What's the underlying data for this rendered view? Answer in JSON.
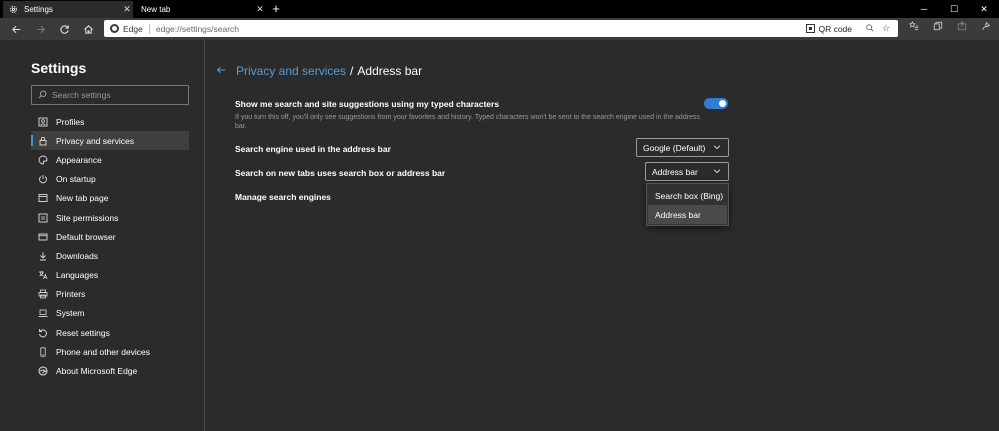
{
  "tabs": [
    {
      "title": "Settings"
    },
    {
      "title": "New tab"
    }
  ],
  "toolbar": {
    "site_label": "Edge",
    "url": "edge://settings/search",
    "qr_label": "QR code"
  },
  "sidebar": {
    "title": "Settings",
    "search_placeholder": "Search settings",
    "items": [
      {
        "label": "Profiles",
        "icon": "profile-icon"
      },
      {
        "label": "Privacy and services",
        "icon": "lock-icon"
      },
      {
        "label": "Appearance",
        "icon": "palette-icon"
      },
      {
        "label": "On startup",
        "icon": "power-icon"
      },
      {
        "label": "New tab page",
        "icon": "newtab-icon"
      },
      {
        "label": "Site permissions",
        "icon": "permissions-icon"
      },
      {
        "label": "Default browser",
        "icon": "browser-icon"
      },
      {
        "label": "Downloads",
        "icon": "download-icon"
      },
      {
        "label": "Languages",
        "icon": "language-icon"
      },
      {
        "label": "Printers",
        "icon": "printer-icon"
      },
      {
        "label": "System",
        "icon": "laptop-icon"
      },
      {
        "label": "Reset settings",
        "icon": "reset-icon"
      },
      {
        "label": "Phone and other devices",
        "icon": "phone-icon"
      },
      {
        "label": "About Microsoft Edge",
        "icon": "edge-logo-icon"
      }
    ]
  },
  "main": {
    "breadcrumb_parent": "Privacy and services",
    "breadcrumb_separator": "/",
    "breadcrumb_current": "Address bar",
    "suggestions_title": "Show me search and site suggestions using my typed characters",
    "suggestions_desc": "If you turn this off, you'll only see suggestions from your favorites and history. Typed characters won't be sent to the search engine used in the address bar.",
    "suggestions_on": true,
    "engine_label": "Search engine used in the address bar",
    "engine_value": "Google (Default)",
    "newtab_label": "Search on new tabs uses search box or address bar",
    "newtab_value": "Address bar",
    "newtab_options": [
      "Search box (Bing)",
      "Address bar"
    ],
    "manage_label": "Manage search engines"
  },
  "colors": {
    "accent": "#3a96dd",
    "link": "#5b9bd5",
    "toggle_on": "#2f7fd1",
    "background": "#2b2b2b"
  }
}
